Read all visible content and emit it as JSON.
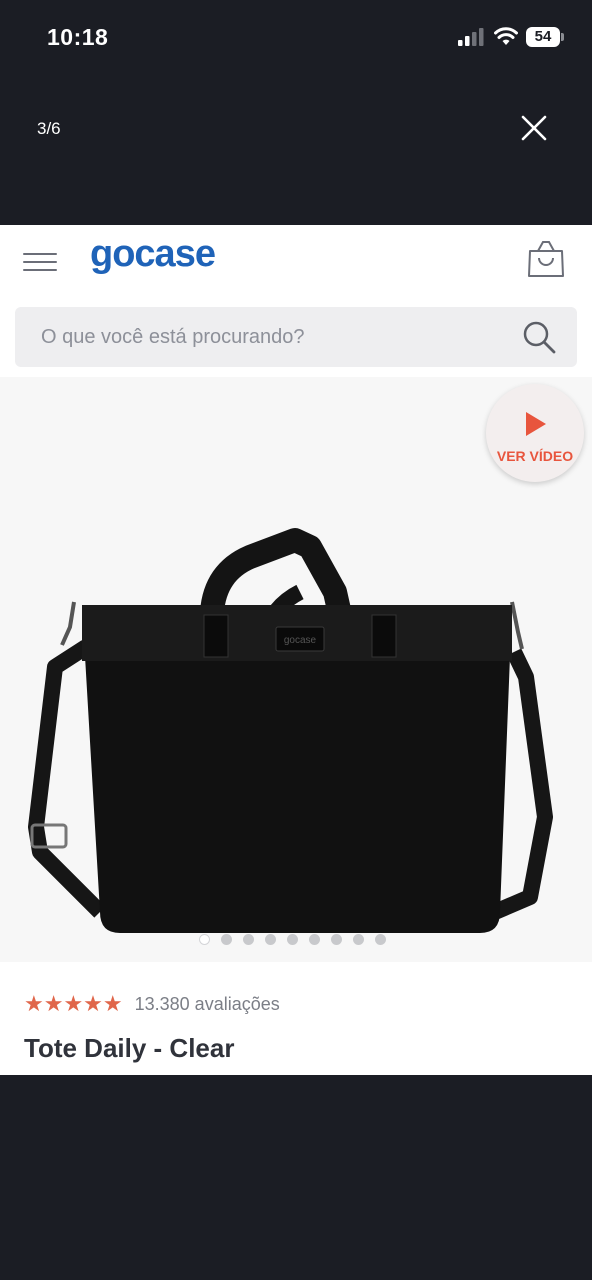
{
  "status_bar": {
    "time": "10:18",
    "battery": "54",
    "icons": [
      "signal-icon",
      "wifi-icon",
      "battery-icon"
    ]
  },
  "viewer": {
    "counter": "3/6",
    "close_icon": "close-icon"
  },
  "site": {
    "logo": "gocase",
    "menu_icon": "hamburger-menu-icon",
    "cart_icon": "shopping-bag-icon"
  },
  "search": {
    "placeholder": "O que você está procurando?",
    "icon": "search-icon"
  },
  "gallery": {
    "video_label": "VER VÍDEO",
    "image_label": "gocase",
    "dot_count": 9,
    "active_dot": 1
  },
  "product": {
    "stars": "★★★★★",
    "rating": 5,
    "reviews": "13.380 avaliações",
    "title": "Tote Daily - Clear"
  },
  "colors": {
    "background": "#1b1d24",
    "brand_blue": "#1f63b8",
    "accent": "#e8553d",
    "stars": "#e0664a"
  }
}
